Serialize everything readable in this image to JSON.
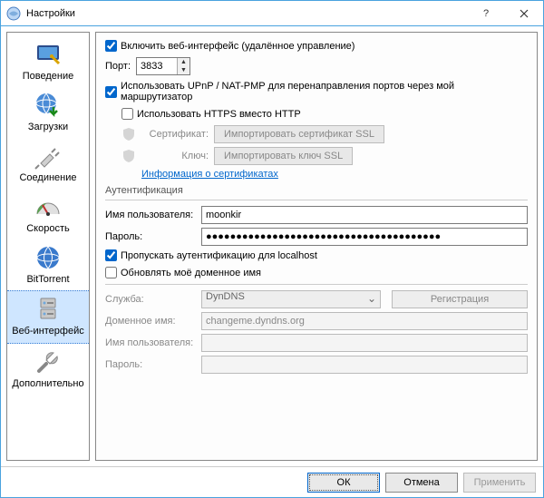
{
  "window": {
    "title": "Настройки"
  },
  "sidebar": {
    "items": [
      {
        "label": "Поведение"
      },
      {
        "label": "Загрузки"
      },
      {
        "label": "Соединение"
      },
      {
        "label": "Скорость"
      },
      {
        "label": "BitTorrent"
      },
      {
        "label": "Веб-интерфейс"
      },
      {
        "label": "Дополнительно"
      }
    ]
  },
  "main": {
    "enable_web": "Включить веб-интерфейс (удалённое управление)",
    "port_label": "Порт:",
    "port_value": "3833",
    "upnp": "Использовать UPnP / NAT-PMP для перенаправления портов через мой маршрутизатор",
    "https": "Использовать HTTPS вместо HTTP",
    "cert_label": "Сертификат:",
    "cert_btn": "Импортировать сертификат SSL",
    "key_label": "Ключ:",
    "key_btn": "Импортировать ключ SSL",
    "cert_info": "Информация о сертификатах",
    "auth_section": "Аутентификация",
    "user_label": "Имя пользователя:",
    "user_value": "moonkir",
    "pass_label": "Пароль:",
    "pass_value": "●●●●●●●●●●●●●●●●●●●●●●●●●●●●●●●●●●●●●●●",
    "bypass": "Пропускать аутентификацию для localhost",
    "ddns_enable": "Обновлять моё доменное имя",
    "ddns_service_label": "Служба:",
    "ddns_service_value": "DynDNS",
    "ddns_reg": "Регистрация",
    "ddns_domain_label": "Доменное имя:",
    "ddns_domain_value": "changeme.dyndns.org",
    "ddns_user_label": "Имя пользователя:",
    "ddns_pass_label": "Пароль:"
  },
  "footer": {
    "ok": "ОК",
    "cancel": "Отмена",
    "apply": "Применить"
  }
}
